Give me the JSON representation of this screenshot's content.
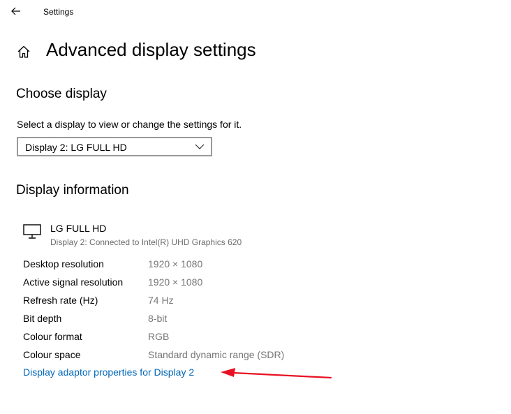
{
  "window": {
    "title": "Settings"
  },
  "page": {
    "title": "Advanced display settings"
  },
  "choose_display": {
    "heading": "Choose display",
    "description": "Select a display to view or change the settings for it.",
    "selected_display": "Display 2: LG FULL HD"
  },
  "display_information": {
    "heading": "Display information",
    "monitor_name": "LG FULL HD",
    "monitor_connection": "Display 2: Connected to Intel(R) UHD Graphics 620",
    "rows": [
      {
        "label": "Desktop resolution",
        "value": "1920 × 1080"
      },
      {
        "label": "Active signal resolution",
        "value": "1920 × 1080"
      },
      {
        "label": "Refresh rate (Hz)",
        "value": "74 Hz"
      },
      {
        "label": "Bit depth",
        "value": "8-bit"
      },
      {
        "label": "Colour format",
        "value": "RGB"
      },
      {
        "label": "Colour space",
        "value": "Standard dynamic range (SDR)"
      }
    ],
    "adaptor_link": "Display adaptor properties for Display 2"
  },
  "colors": {
    "link": "#0067b8",
    "annotation_arrow": "#e81123",
    "secondary_text": "#767676"
  },
  "icons": {
    "back": "back-arrow-icon",
    "home": "home-icon",
    "dropdown": "chevron-down-icon",
    "monitor": "monitor-icon"
  }
}
